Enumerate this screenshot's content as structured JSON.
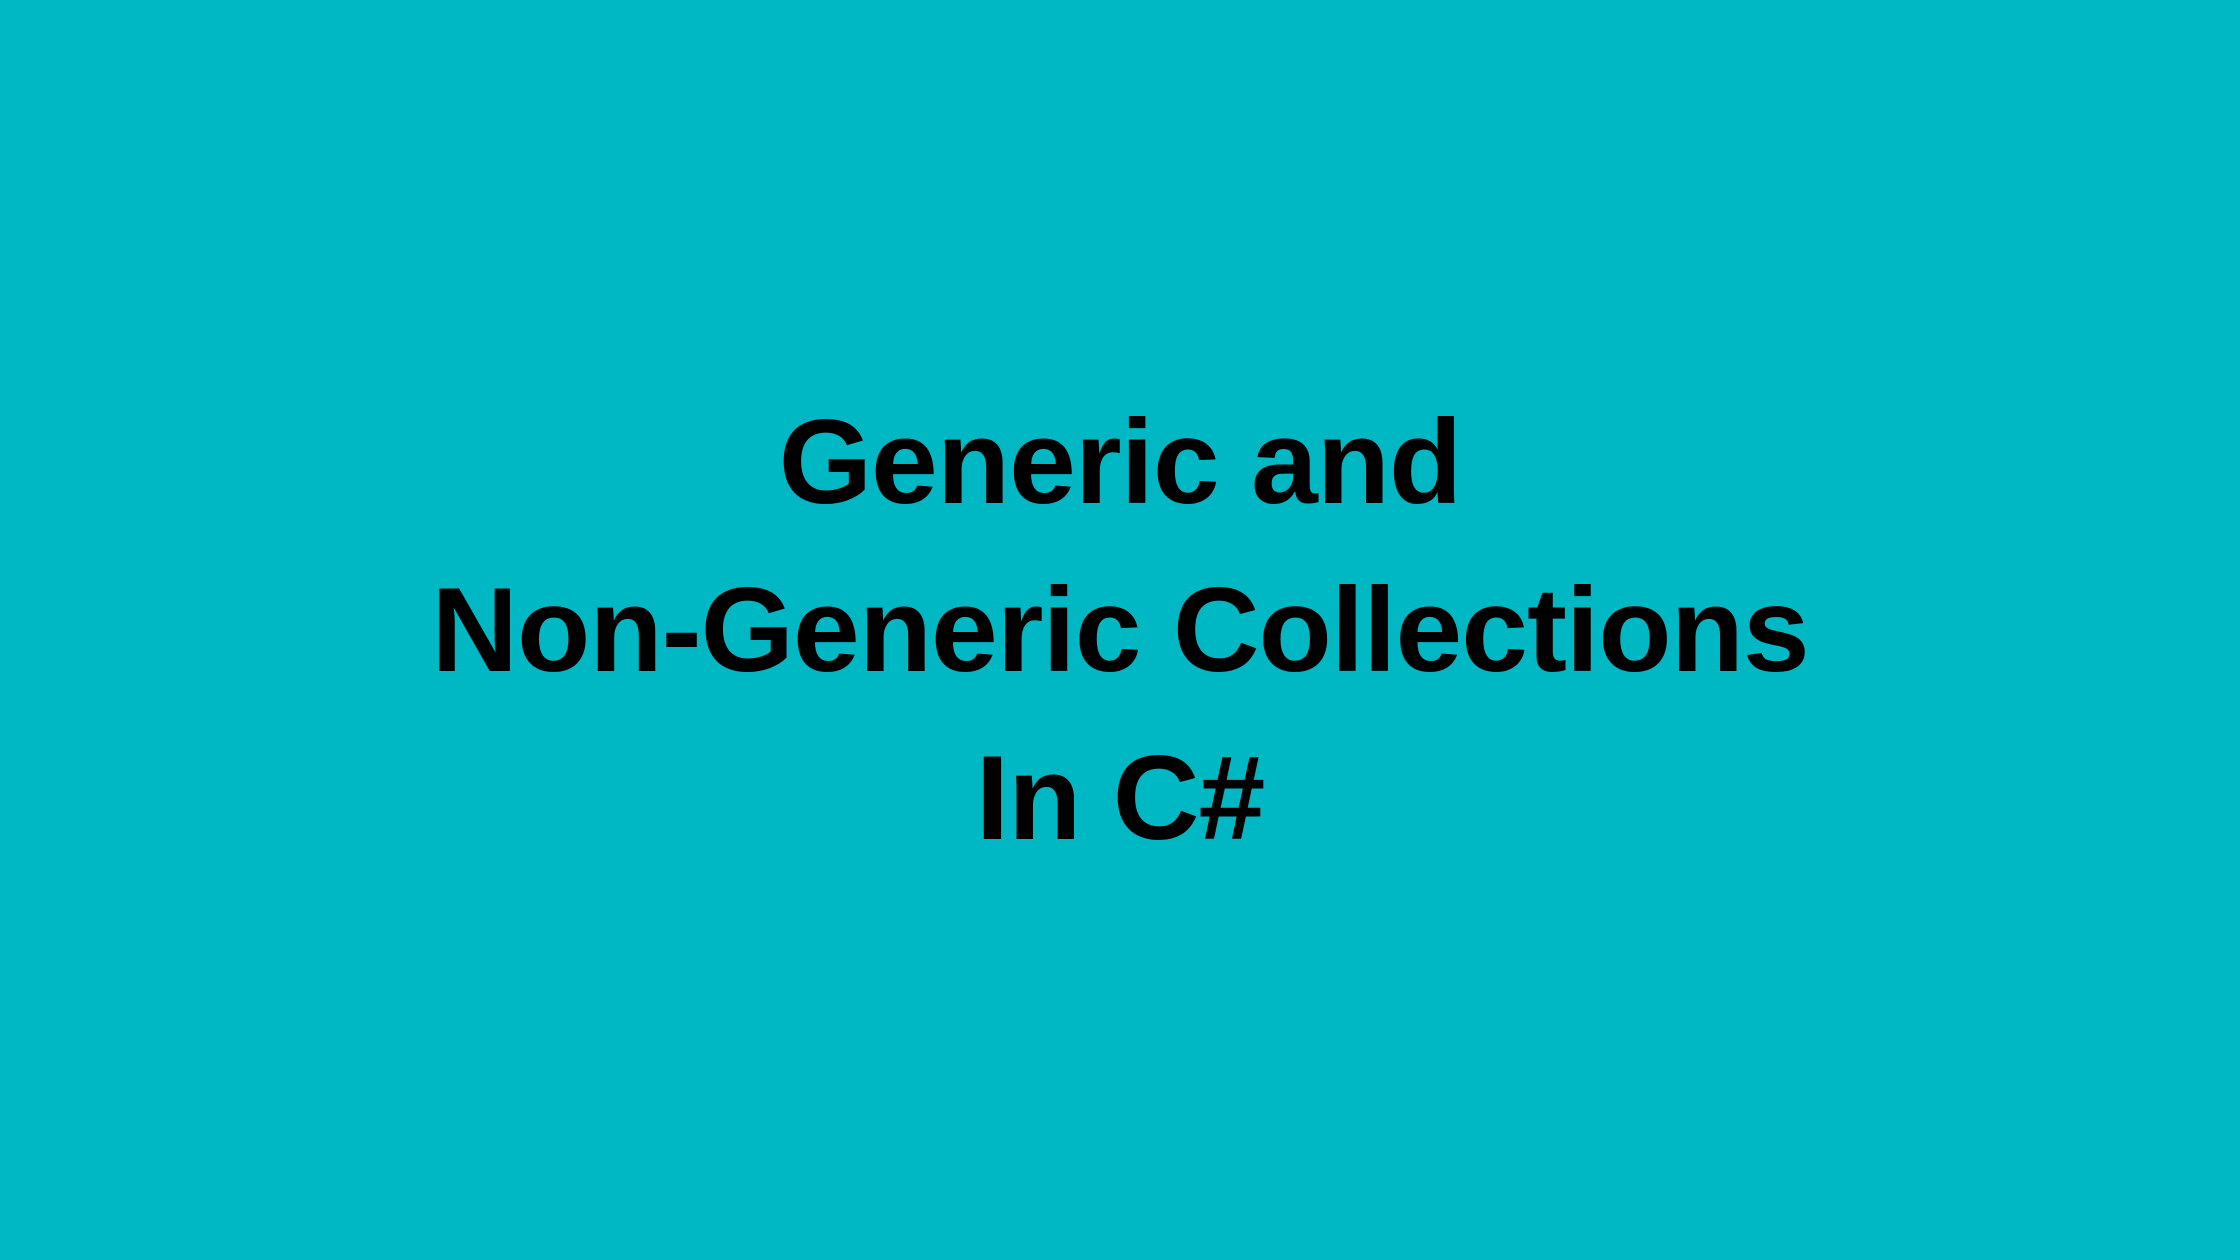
{
  "title": {
    "line1": "Generic and",
    "line2": "Non-Generic Collections",
    "line3": "In C#"
  },
  "colors": {
    "background": "#00b8c4",
    "text": "#000000"
  }
}
